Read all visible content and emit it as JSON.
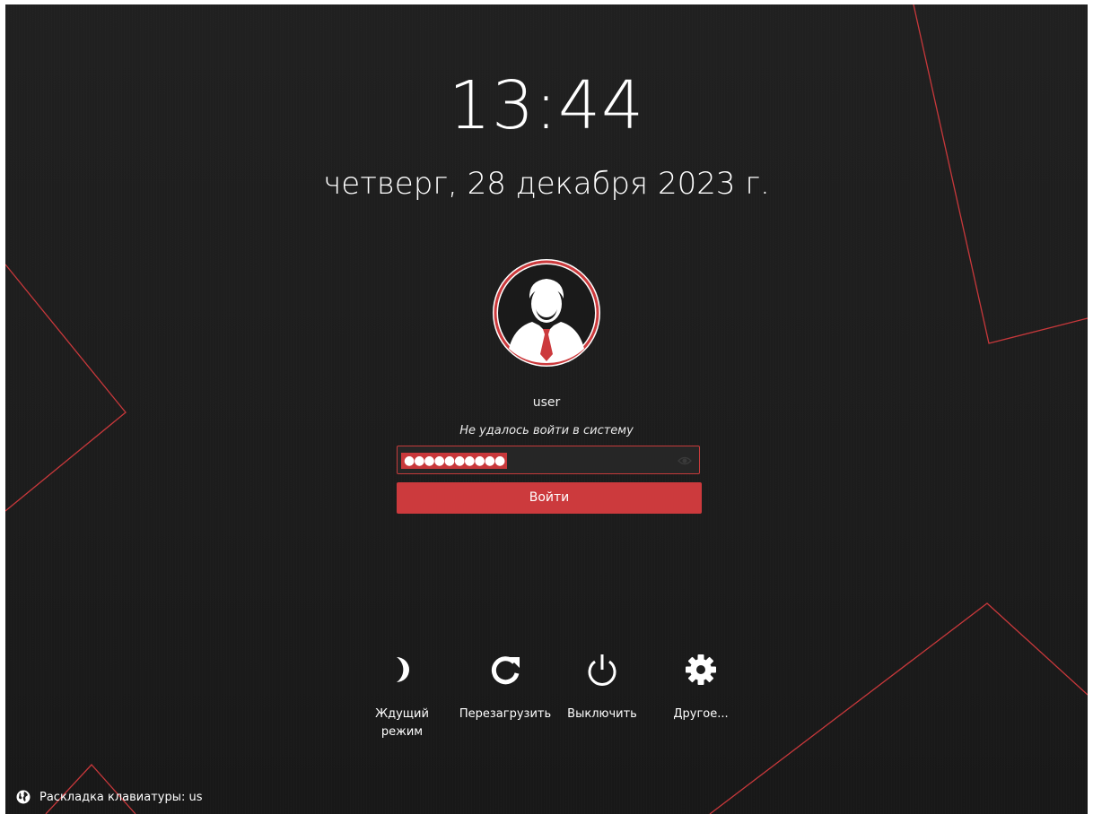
{
  "clock": {
    "time": "13:44",
    "date": "четверг, 28 декабря 2023 г."
  },
  "user": {
    "name": "user",
    "avatar_icon": "user-avatar-icon"
  },
  "login": {
    "status_message": "Не удалось войти в систему",
    "password_masked": "●●●●●●●●●●",
    "button_label": "Войти"
  },
  "actions": [
    {
      "label": "Ждущий режим",
      "icon": "moon-icon"
    },
    {
      "label": "Перезагрузить",
      "icon": "reload-icon"
    },
    {
      "label": "Выключить",
      "icon": "power-icon"
    },
    {
      "label": "Другое...",
      "icon": "gear-icon"
    }
  ],
  "keyboard": {
    "label": "Раскладка клавиатуры: us",
    "icon": "globe-icon"
  },
  "colors": {
    "accent": "#cc3a3d",
    "background": "#1e1e1e",
    "text": "#ffffff"
  }
}
